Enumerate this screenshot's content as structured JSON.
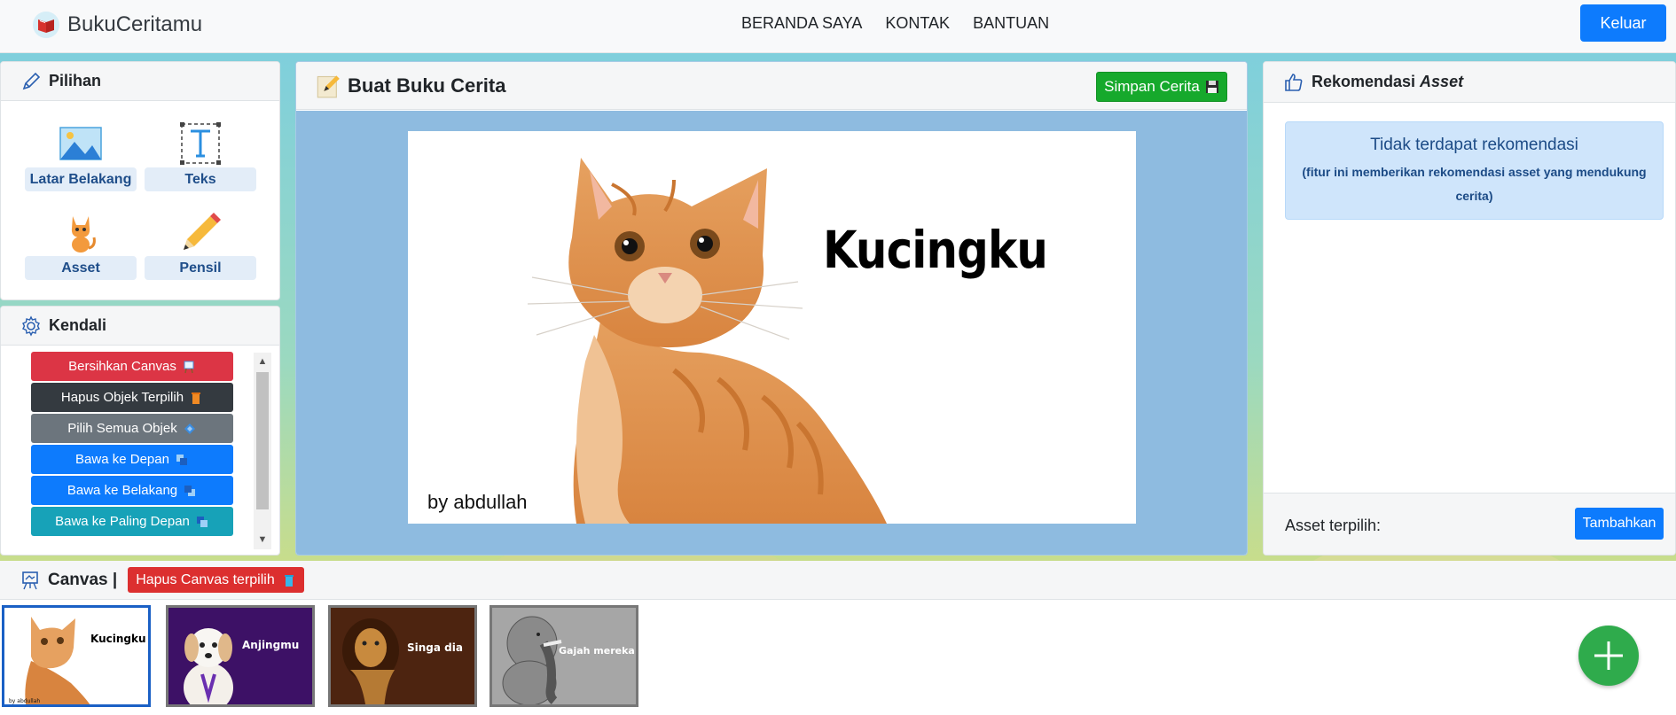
{
  "navbar": {
    "brand": "BukuCeritamu",
    "links": [
      "BERANDA SAYA",
      "KONTAK",
      "BANTUAN"
    ],
    "logout_label": "Keluar"
  },
  "pilihan": {
    "title": "Pilihan",
    "options": [
      "Latar Belakang",
      "Teks",
      "Asset",
      "Pensil"
    ]
  },
  "kendali": {
    "title": "Kendali",
    "buttons": [
      {
        "label": "Bersihkan Canvas",
        "color": "#dc3545"
      },
      {
        "label": "Hapus Objek Terpilih",
        "color": "#343a40"
      },
      {
        "label": "Pilih Semua Objek",
        "color": "#6c757d"
      },
      {
        "label": "Bawa ke Depan",
        "color": "#0d7bfd"
      },
      {
        "label": "Bawa ke Belakang",
        "color": "#0d7bfd"
      },
      {
        "label": "Bawa ke Paling Depan",
        "color": "#17a2b8"
      }
    ]
  },
  "editor": {
    "title": "Buat Buku Cerita",
    "save_label": "Simpan Cerita",
    "canvas_title": "Kucingku",
    "canvas_author": "by abdullah"
  },
  "rekomendasi": {
    "title_main": "Rekomendasi ",
    "title_em": "Asset",
    "empty_title": "Tidak terdapat rekomendasi",
    "empty_desc": "(fitur ini memberikan rekomendasi asset yang mendukung cerita)",
    "selected_label": "Asset terpilih:",
    "add_label": "Tambahkan"
  },
  "canvas_strip": {
    "title": "Canvas |",
    "delete_label": "Hapus Canvas terpilih",
    "thumbnails": [
      {
        "caption": "Kucingku",
        "author": "by abdullah",
        "bg": "#ffffff",
        "selected": true
      },
      {
        "caption": "Anjingmu",
        "bg": "#3d1166",
        "selected": false
      },
      {
        "caption": "Singa dia",
        "bg": "#4d2410",
        "selected": false
      },
      {
        "caption": "Gajah mereka",
        "bg": "#a6a6a6",
        "selected": false
      }
    ]
  }
}
